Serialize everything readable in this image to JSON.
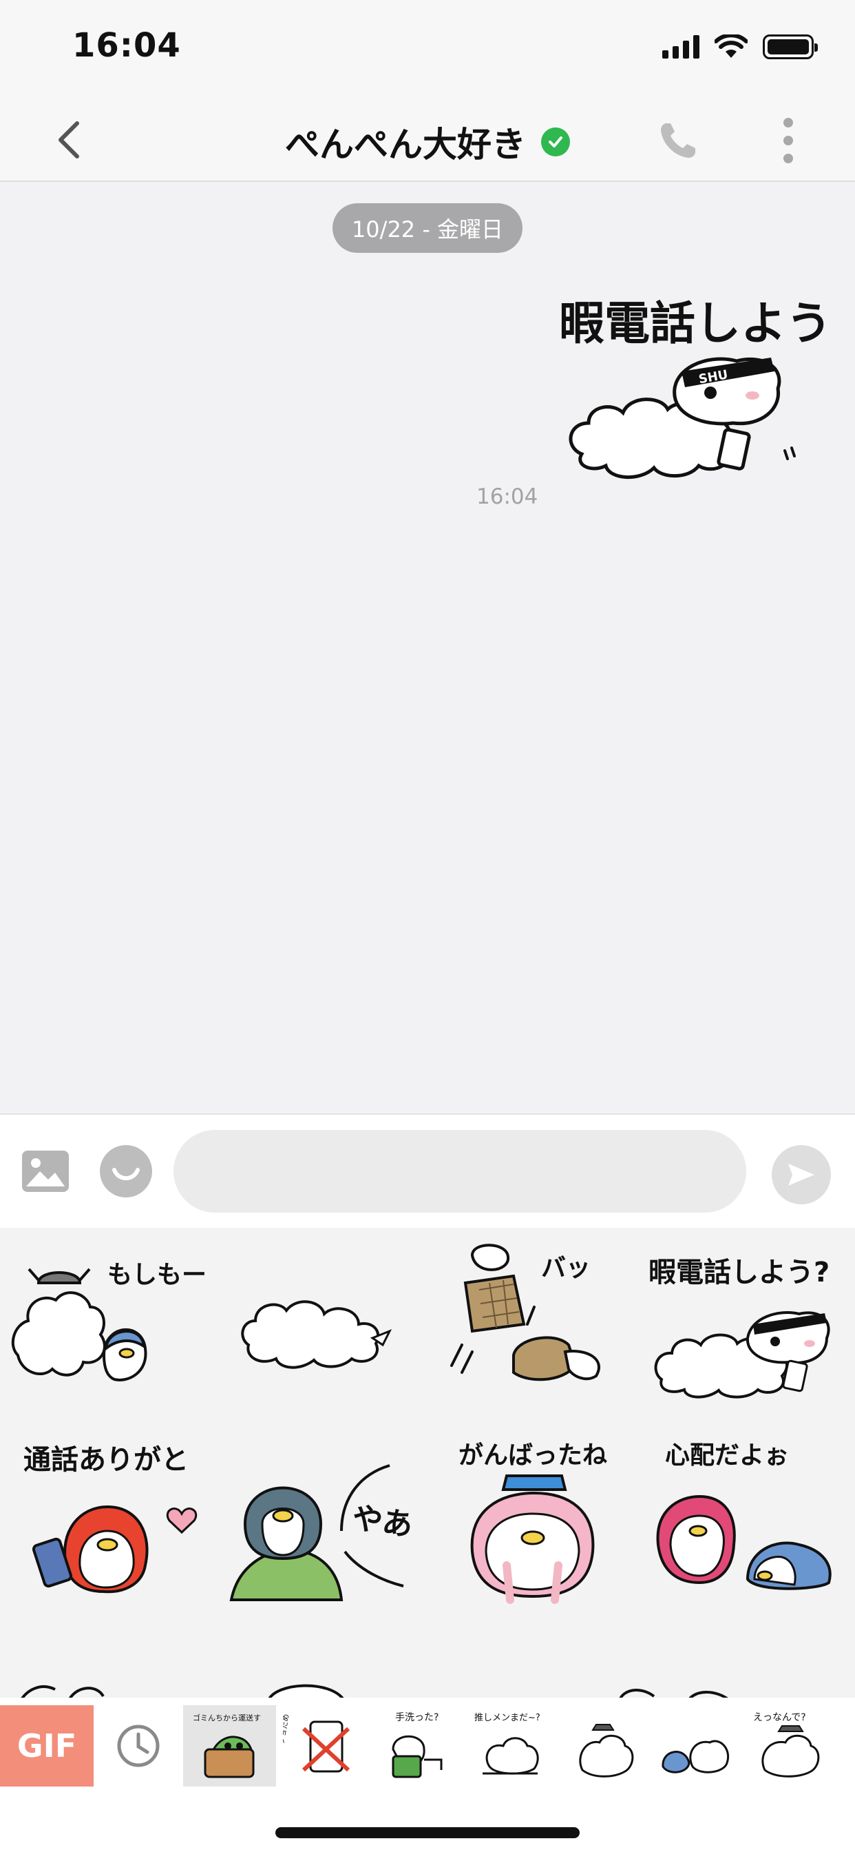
{
  "status_bar": {
    "time": "16:04",
    "battery_icon": "battery-full-icon",
    "wifi_icon": "wifi-icon",
    "signal_icon": "cellular-signal-icon"
  },
  "header": {
    "title": "ぺんぺん大好き",
    "verified_icon": "verified-check-icon",
    "back_icon": "chevron-left-icon",
    "call_icon": "phone-icon",
    "more_icon": "more-vertical-icon"
  },
  "chat": {
    "date_separator": "10/22 - 金曜日",
    "messages": [
      {
        "type": "sticker",
        "sticker_text": "暇電話しよう?",
        "sticker_badge": "SHU",
        "time": "16:04"
      }
    ]
  },
  "input_bar": {
    "image_icon": "image-icon",
    "emoji_icon": "emoji-icon",
    "placeholder": "",
    "send_icon": "send-icon"
  },
  "sticker_panel": {
    "stickers": [
      {
        "text": "もしもーし"
      },
      {
        "text": ""
      },
      {
        "text": "バッ"
      },
      {
        "text": "暇電話しよう?"
      },
      {
        "text": "通話ありがと"
      },
      {
        "text": "やあ"
      },
      {
        "text": "がんばったね"
      },
      {
        "text": "心配だよぉ"
      }
    ]
  },
  "sticker_tabs": {
    "gif_label": "GIF",
    "recent_icon": "clock-icon",
    "packs": [
      {
        "caption": "ゴミんちから運送す",
        "active": true
      },
      {
        "caption": "スクショだめ"
      },
      {
        "caption": "手洗った?"
      },
      {
        "caption": "推しメンまだ~?"
      },
      {
        "caption": ""
      },
      {
        "caption": ""
      },
      {
        "caption": "えっなんで?"
      }
    ]
  },
  "colors": {
    "verified": "#2fb84f",
    "gif_tab": "#f38e7b",
    "date_pill": "#a8a8aa"
  }
}
